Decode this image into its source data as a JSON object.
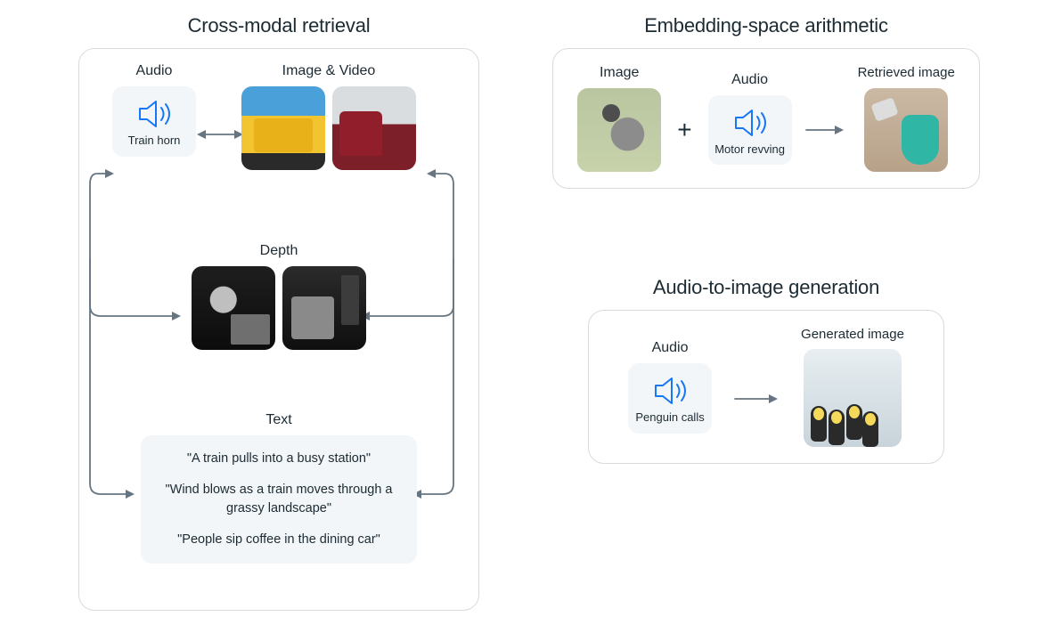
{
  "left": {
    "title": "Cross-modal retrieval",
    "audio_label": "Audio",
    "audio_caption": "Train horn",
    "imgvid_label": "Image & Video",
    "depth_label": "Depth",
    "text_label": "Text",
    "quotes": [
      "\"A train pulls into a busy station\"",
      "\"Wind blows as a train moves through a grassy landscape\"",
      "\"People sip coffee in the dining car\""
    ]
  },
  "arith": {
    "title": "Embedding-space arithmetic",
    "image_label": "Image",
    "audio_label": "Audio",
    "audio_caption": "Motor revving",
    "retrieved_label": "Retrieved image"
  },
  "a2i": {
    "title": "Audio-to-image generation",
    "audio_label": "Audio",
    "audio_caption": "Penguin calls",
    "gen_label": "Generated image"
  },
  "icons": {
    "pigeon": "pigeon",
    "scooter": "scooter",
    "penguins": "penguins"
  }
}
